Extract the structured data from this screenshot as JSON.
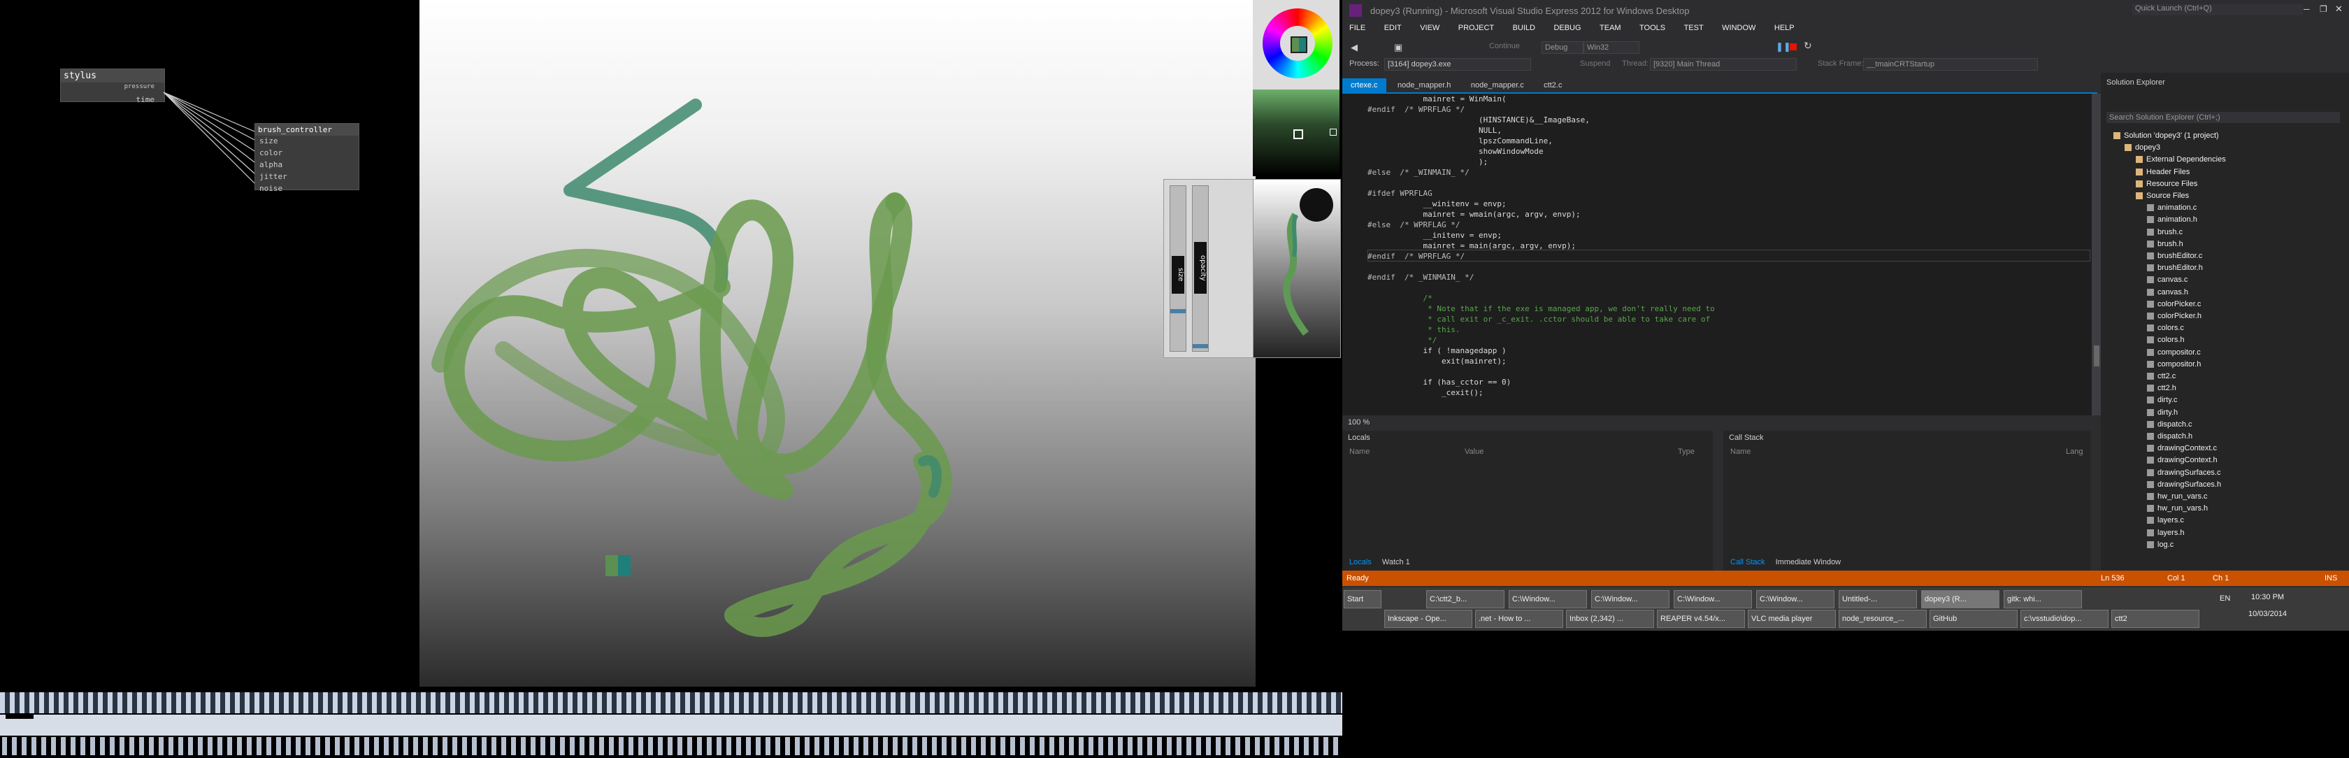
{
  "node_graph": {
    "stylus_node": {
      "title": "stylus",
      "outputs": [
        "pressure",
        "time"
      ]
    },
    "brush_node": {
      "title": "brush_controller",
      "inputs": [
        "size",
        "color",
        "alpha",
        "jitter",
        "noise"
      ]
    }
  },
  "sliders": {
    "size_label": "size",
    "opacity_label": "opacity"
  },
  "vs": {
    "window_title": "dopey3 (Running) - Microsoft Visual Studio Express 2012 for Windows Desktop",
    "quick_launch": "Quick Launch (Ctrl+Q)",
    "menu": [
      "FILE",
      "EDIT",
      "VIEW",
      "PROJECT",
      "BUILD",
      "DEBUG",
      "TEAM",
      "TOOLS",
      "TEST",
      "WINDOW",
      "HELP"
    ],
    "toolbar": {
      "continue_label": "Continue",
      "config": "Debug",
      "platform": "Win32"
    },
    "process": {
      "label": "Process:",
      "value": "[3164] dopey3.exe",
      "suspend": "Suspend",
      "thread_label": "Thread:",
      "thread": "[9320] Main Thread",
      "stack_label": "Stack Frame:",
      "stack": "__tmainCRTStartup"
    },
    "doc_tabs": [
      "crtexe.c",
      "node_mapper.h",
      "node_mapper.c",
      "ctt2.c"
    ],
    "code_lines": [
      {
        "text": "            mainret = WinMain(",
        "cls": "c-def"
      },
      {
        "text": "#endif  /* WPRFLAG */",
        "cls": "c-pp"
      },
      {
        "text": "                        (HINSTANCE)&__ImageBase,",
        "cls": "c-def"
      },
      {
        "text": "                        NULL,",
        "cls": "c-def"
      },
      {
        "text": "                        lpszCommandLine,",
        "cls": "c-def"
      },
      {
        "text": "                        showWindowMode",
        "cls": "c-def"
      },
      {
        "text": "                        );",
        "cls": "c-def"
      },
      {
        "text": "#else  /* _WINMAIN_ */",
        "cls": "c-pp"
      },
      {
        "text": "",
        "cls": "c-def"
      },
      {
        "text": "#ifdef WPRFLAG",
        "cls": "c-pp"
      },
      {
        "text": "            __winitenv = envp;",
        "cls": "c-def"
      },
      {
        "text": "            mainret = wmain(argc, argv, envp);",
        "cls": "c-def"
      },
      {
        "text": "#else  /* WPRFLAG */",
        "cls": "c-pp"
      },
      {
        "text": "            __initenv = envp;",
        "cls": "c-def"
      },
      {
        "text": "            mainret = main(argc, argv, envp);",
        "cls": "c-def"
      },
      {
        "text": "#endif  /* WPRFLAG */",
        "cls": "c-pp"
      },
      {
        "text": "",
        "cls": "c-def"
      },
      {
        "text": "#endif  /* _WINMAIN_ */",
        "cls": "c-pp"
      },
      {
        "text": "",
        "cls": "c-def"
      },
      {
        "text": "            /*",
        "cls": "c-com"
      },
      {
        "text": "             * Note that if the exe is managed app, we don't really need to",
        "cls": "c-com"
      },
      {
        "text": "             * call exit or _c_exit. .cctor should be able to take care of",
        "cls": "c-com"
      },
      {
        "text": "             * this.",
        "cls": "c-com"
      },
      {
        "text": "             */",
        "cls": "c-com"
      },
      {
        "text": "            if ( !managedapp )",
        "cls": "c-def"
      },
      {
        "text": "                exit(mainret);",
        "cls": "c-def"
      },
      {
        "text": "",
        "cls": "c-def"
      },
      {
        "text": "            if (has_cctor == 0)",
        "cls": "c-def"
      },
      {
        "text": "                _cexit();",
        "cls": "c-def"
      }
    ],
    "zoom": "100 %",
    "locals": {
      "title": "Locals",
      "col_name": "Name",
      "col_value": "Value",
      "col_type": "Type",
      "tabs": [
        "Locals",
        "Watch 1"
      ]
    },
    "callstack": {
      "title": "Call Stack",
      "col_name": "Name",
      "col_lang": "Lang",
      "tabs": [
        "Call Stack",
        "Immediate Window"
      ]
    },
    "solution": {
      "title": "Solution Explorer",
      "search": "Search Solution Explorer (Ctrl+;)",
      "items": [
        {
          "label": "Solution 'dopey3' (1 project)",
          "indent": 0
        },
        {
          "label": "dopey3",
          "indent": 1
        },
        {
          "label": "External Dependencies",
          "indent": 2
        },
        {
          "label": "Header Files",
          "indent": 2
        },
        {
          "label": "Resource Files",
          "indent": 2
        },
        {
          "label": "Source Files",
          "indent": 2
        },
        {
          "label": "animation.c",
          "indent": 3
        },
        {
          "label": "animation.h",
          "indent": 3
        },
        {
          "label": "brush.c",
          "indent": 3
        },
        {
          "label": "brush.h",
          "indent": 3
        },
        {
          "label": "brushEditor.c",
          "indent": 3
        },
        {
          "label": "brushEditor.h",
          "indent": 3
        },
        {
          "label": "canvas.c",
          "indent": 3
        },
        {
          "label": "canvas.h",
          "indent": 3
        },
        {
          "label": "colorPicker.c",
          "indent": 3
        },
        {
          "label": "colorPicker.h",
          "indent": 3
        },
        {
          "label": "colors.c",
          "indent": 3
        },
        {
          "label": "colors.h",
          "indent": 3
        },
        {
          "label": "compositor.c",
          "indent": 3
        },
        {
          "label": "compositor.h",
          "indent": 3
        },
        {
          "label": "ctt2.c",
          "indent": 3
        },
        {
          "label": "ctt2.h",
          "indent": 3
        },
        {
          "label": "dirty.c",
          "indent": 3
        },
        {
          "label": "dirty.h",
          "indent": 3
        },
        {
          "label": "dispatch.c",
          "indent": 3
        },
        {
          "label": "dispatch.h",
          "indent": 3
        },
        {
          "label": "drawingContext.c",
          "indent": 3
        },
        {
          "label": "drawingContext.h",
          "indent": 3
        },
        {
          "label": "drawingSurfaces.c",
          "indent": 3
        },
        {
          "label": "drawingSurfaces.h",
          "indent": 3
        },
        {
          "label": "hw_run_vars.c",
          "indent": 3
        },
        {
          "label": "hw_run_vars.h",
          "indent": 3
        },
        {
          "label": "layers.c",
          "indent": 3
        },
        {
          "label": "layers.h",
          "indent": 3
        },
        {
          "label": "log.c",
          "indent": 3
        }
      ]
    },
    "status": {
      "ready": "Ready",
      "ln": "Ln 536",
      "col": "Col 1",
      "ch": "Ch 1",
      "ins": "INS"
    },
    "taskbar": {
      "row1": [
        "Start",
        "C:\\ctt2_b...",
        "C:\\Window...",
        "C:\\Window...",
        "C:\\Window...",
        "C:\\Window...",
        "Untitled-...",
        "dopey3 (R...",
        "gitk: whi..."
      ],
      "row2": [
        "Inkscape - Ope...",
        ".net - How to ...",
        "Inbox (2,342) ...",
        "REAPER v4.54/x...",
        "VLC media player",
        "node_resource_...",
        "GitHub",
        "c:\\vsstudio\\dop...",
        "ctt2"
      ],
      "lang": "EN",
      "time": "10:30 PM",
      "date": "10/03/2014"
    }
  }
}
